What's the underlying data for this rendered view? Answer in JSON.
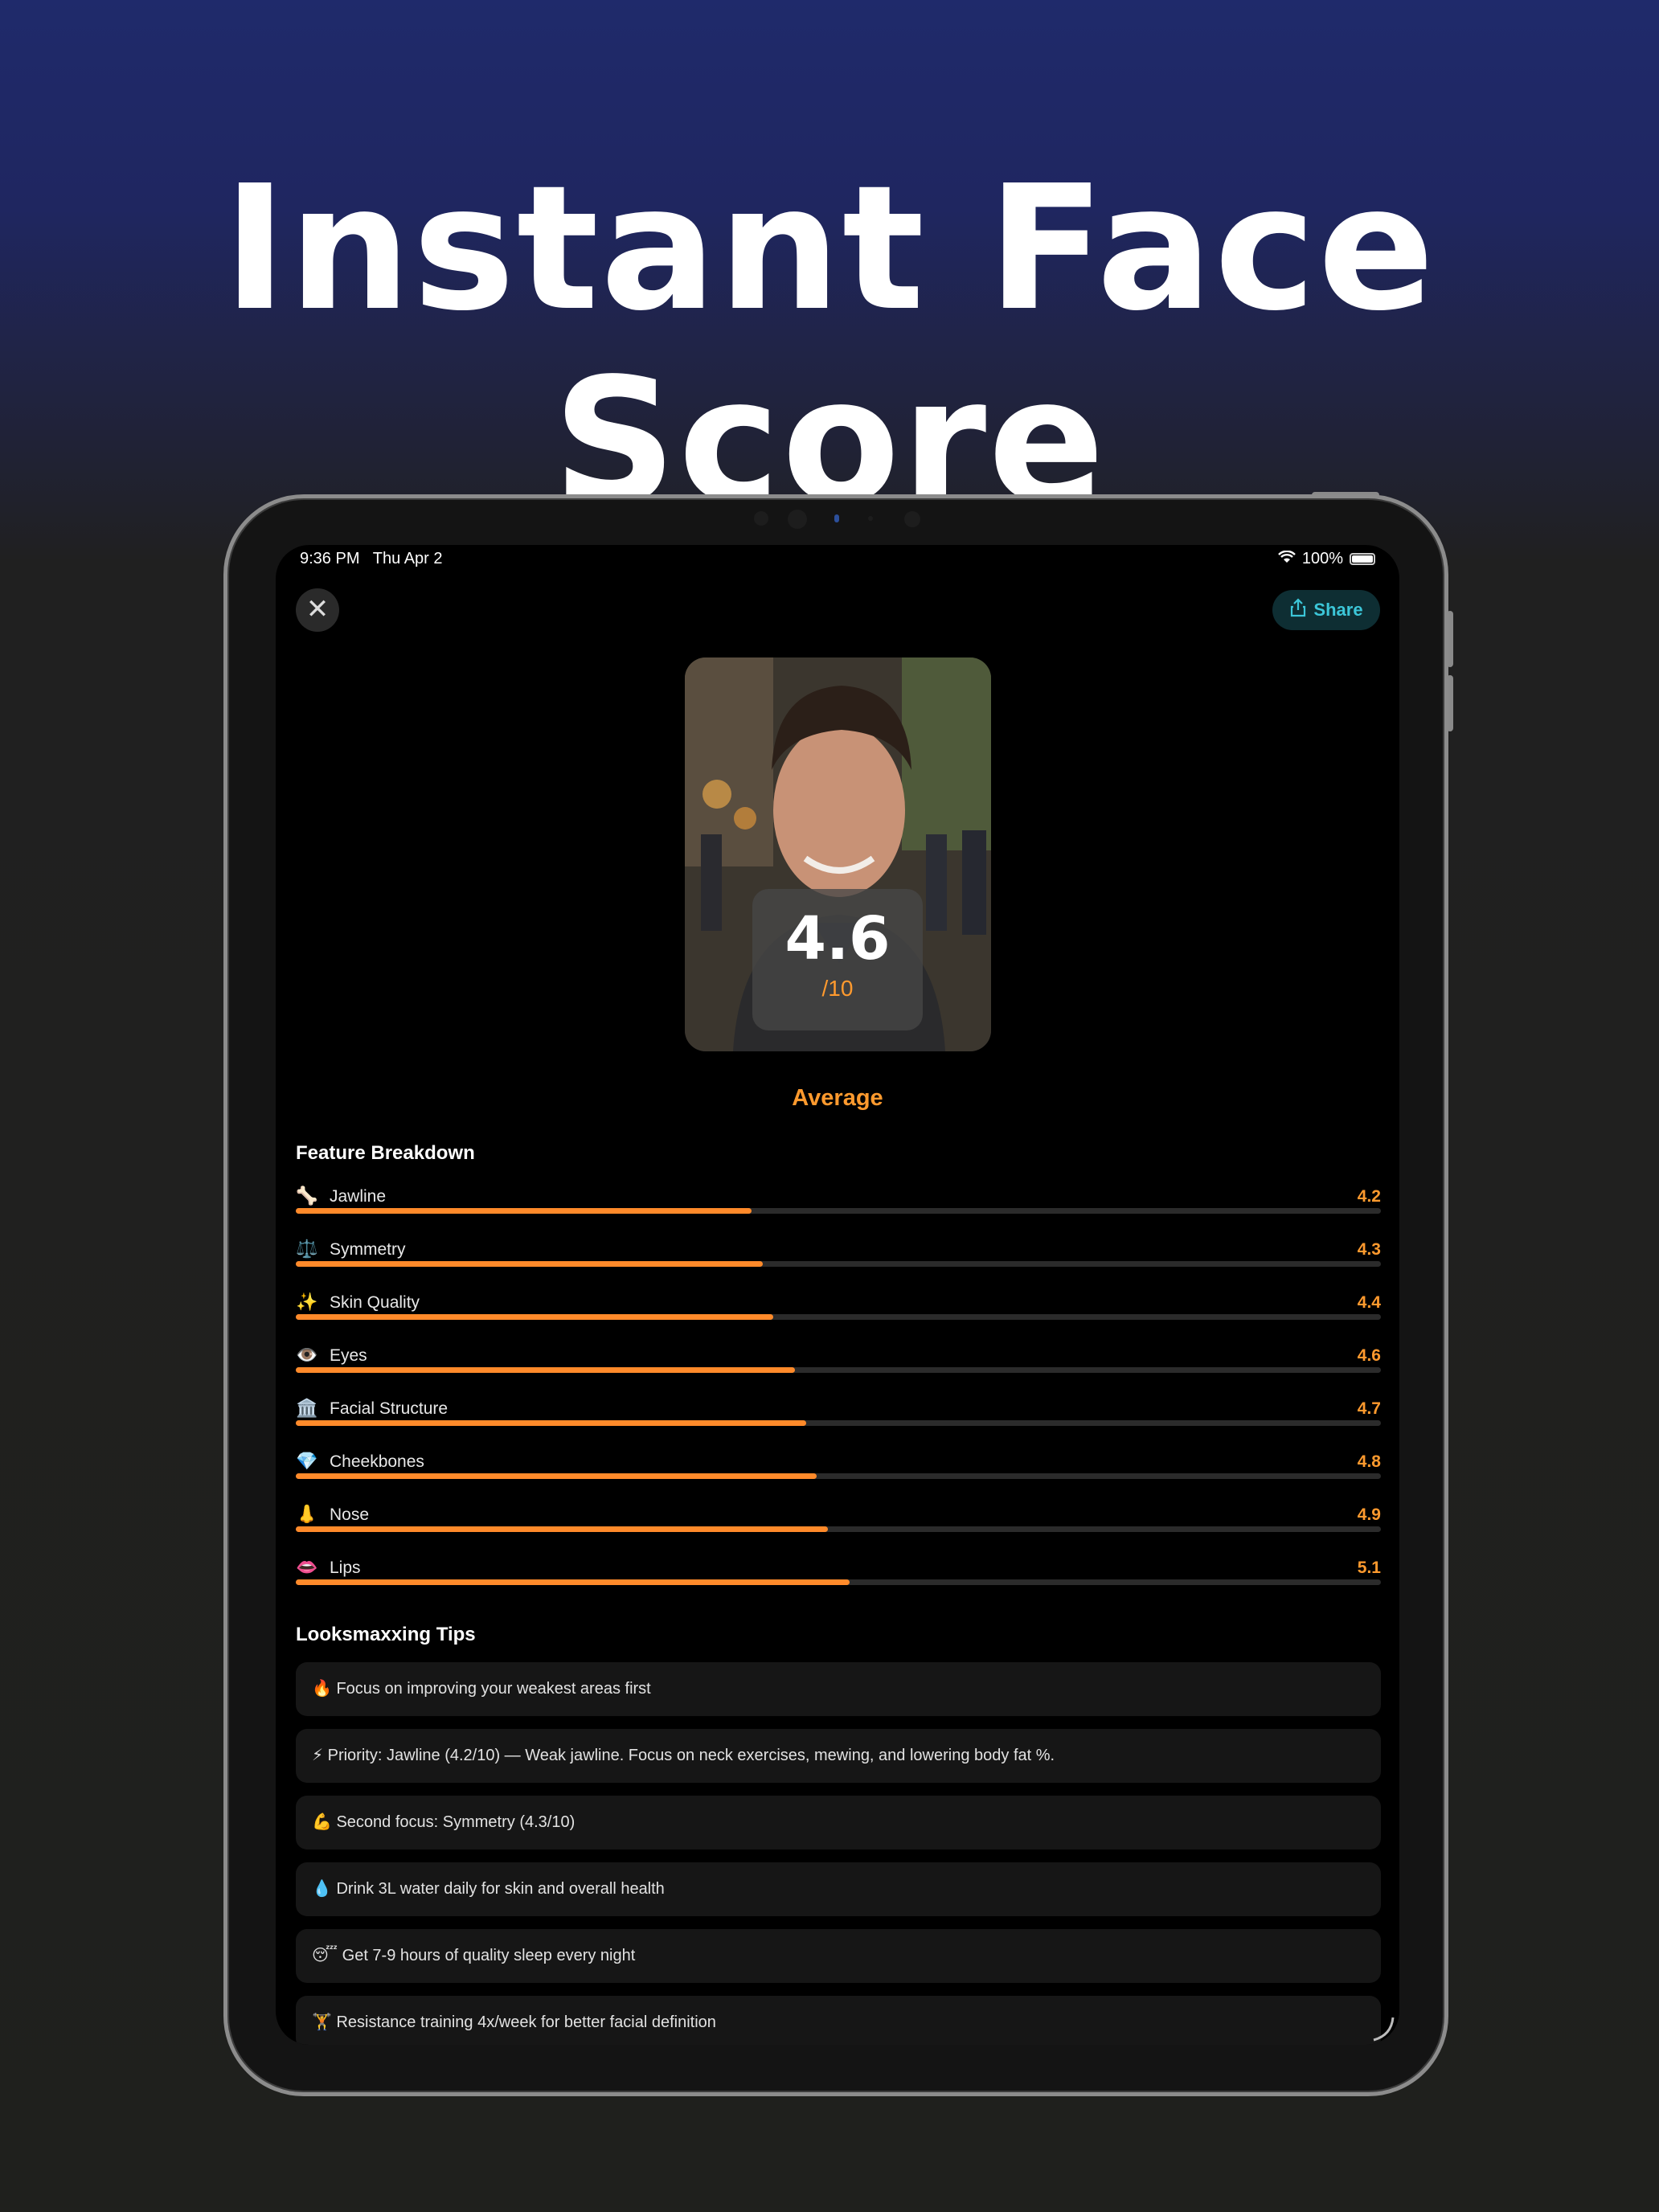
{
  "headline": "Instant Face Score",
  "status": {
    "time": "9:36 PM",
    "date": "Thu Apr 2",
    "battery": "100%"
  },
  "toolbar": {
    "close_icon": "close-icon",
    "share_label": "Share",
    "share_icon": "share-icon"
  },
  "score": {
    "value": "4.6",
    "denominator": "/10",
    "rating": "Average"
  },
  "breakdown": {
    "title": "Feature Breakdown",
    "max": 10,
    "items": [
      {
        "emoji": "🦴",
        "label": "Jawline",
        "value": "4.2",
        "fill": 0.42
      },
      {
        "emoji": "⚖️",
        "label": "Symmetry",
        "value": "4.3",
        "fill": 0.43
      },
      {
        "emoji": "✨",
        "label": "Skin Quality",
        "value": "4.4",
        "fill": 0.44
      },
      {
        "emoji": "👁️",
        "label": "Eyes",
        "value": "4.6",
        "fill": 0.46
      },
      {
        "emoji": "🏛️",
        "label": "Facial Structure",
        "value": "4.7",
        "fill": 0.47
      },
      {
        "emoji": "💎",
        "label": "Cheekbones",
        "value": "4.8",
        "fill": 0.48
      },
      {
        "emoji": "👃",
        "label": "Nose",
        "value": "4.9",
        "fill": 0.49
      },
      {
        "emoji": "👄",
        "label": "Lips",
        "value": "5.1",
        "fill": 0.51
      }
    ]
  },
  "tips": {
    "title": "Looksmaxxing Tips",
    "items": [
      "🔥 Focus on improving your weakest areas first",
      "⚡ Priority: Jawline (4.2/10) — Weak jawline. Focus on neck exercises, mewing, and lowering body fat %.",
      "💪 Second focus: Symmetry (4.3/10)",
      "💧 Drink 3L water daily for skin and overall health",
      "😴 Get 7-9 hours of quality sleep every night",
      "🏋️ Resistance training 4x/week for better facial definition"
    ]
  },
  "colors": {
    "accent": "#ff9a2e",
    "share": "#3cc6d8",
    "background_top": "#1f2a6b",
    "background_bottom": "#1f201d"
  }
}
